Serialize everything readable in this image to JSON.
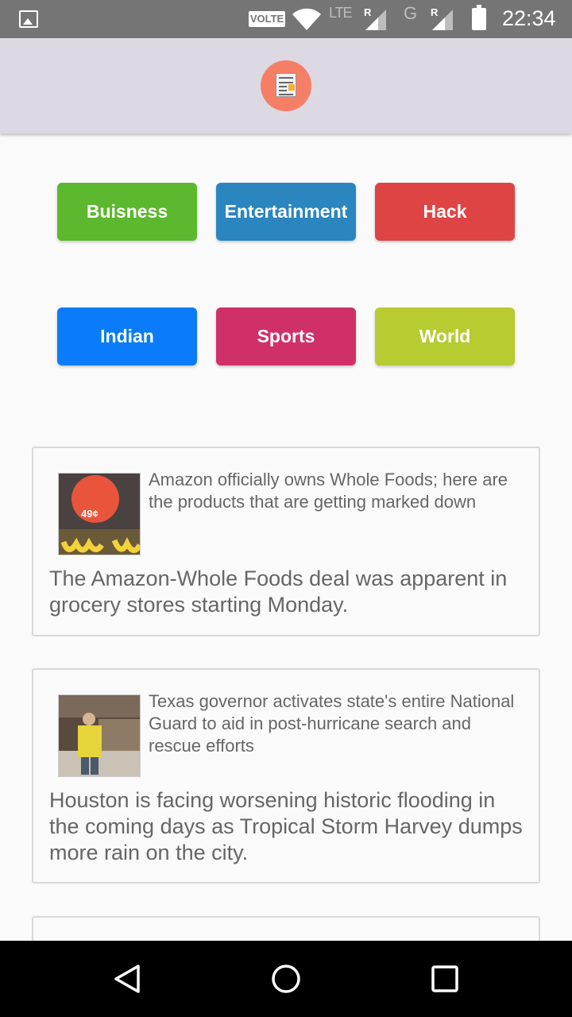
{
  "status_bar": {
    "volte": "VOLTE",
    "lte": "LTE",
    "roaming1": "R",
    "network2": "G",
    "roaming2": "R",
    "time": "22:34"
  },
  "categories": [
    {
      "label": "Buisness",
      "color": "#5cb82e"
    },
    {
      "label": "Entertainment",
      "color": "#2b86bf"
    },
    {
      "label": "Hack",
      "color": "#de4444"
    },
    {
      "label": "Indian",
      "color": "#0a7cf9"
    },
    {
      "label": "Sports",
      "color": "#cf3068"
    },
    {
      "label": "World",
      "color": "#b8cb30"
    }
  ],
  "articles": [
    {
      "title": "Amazon officially owns Whole Foods; here are the products that are getting marked down",
      "description": "The Amazon-Whole Foods deal was apparent in grocery stores starting Monday.",
      "thumb_price": "49¢"
    },
    {
      "title": "Texas governor activates state's entire National Guard to aid in post-hurricane search and rescue efforts",
      "description": "Houston is facing worsening historic flooding in the coming days as Tropical Storm Harvey dumps more rain on the city."
    }
  ]
}
